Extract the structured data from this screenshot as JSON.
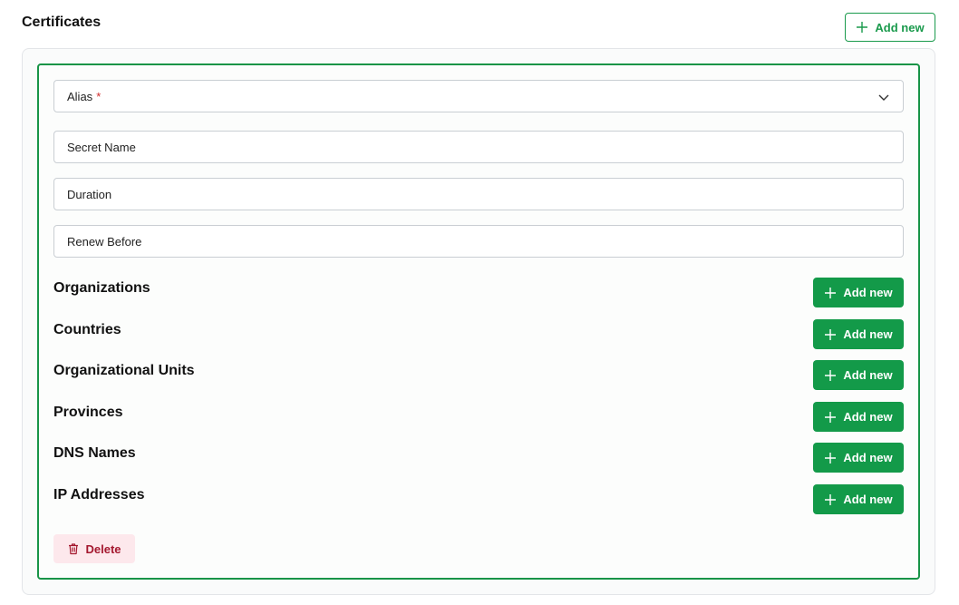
{
  "section": {
    "title": "Certificates"
  },
  "header_add_button": {
    "label": "Add new",
    "icon": "plus-icon"
  },
  "fields": {
    "alias": {
      "label": "Alias",
      "required_mark": "*",
      "icon": "chevron-down-icon"
    },
    "secret_name": {
      "placeholder": "Secret Name"
    },
    "duration": {
      "placeholder": "Duration"
    },
    "renew_before": {
      "placeholder": "Renew Before"
    }
  },
  "groups": [
    {
      "label": "Organizations",
      "add_label": "Add new"
    },
    {
      "label": "Countries",
      "add_label": "Add new"
    },
    {
      "label": "Organizational Units",
      "add_label": "Add new"
    },
    {
      "label": "Provinces",
      "add_label": "Add new"
    },
    {
      "label": "DNS Names",
      "add_label": "Add new"
    },
    {
      "label": "IP Addresses",
      "add_label": "Add new"
    }
  ],
  "delete_button": {
    "label": "Delete",
    "icon": "trash-icon"
  },
  "colors": {
    "accent": "#139a49",
    "accent_border": "#189447",
    "danger_text": "#a4182f",
    "danger_bg": "#fde8ec",
    "required": "#d12b2b"
  }
}
